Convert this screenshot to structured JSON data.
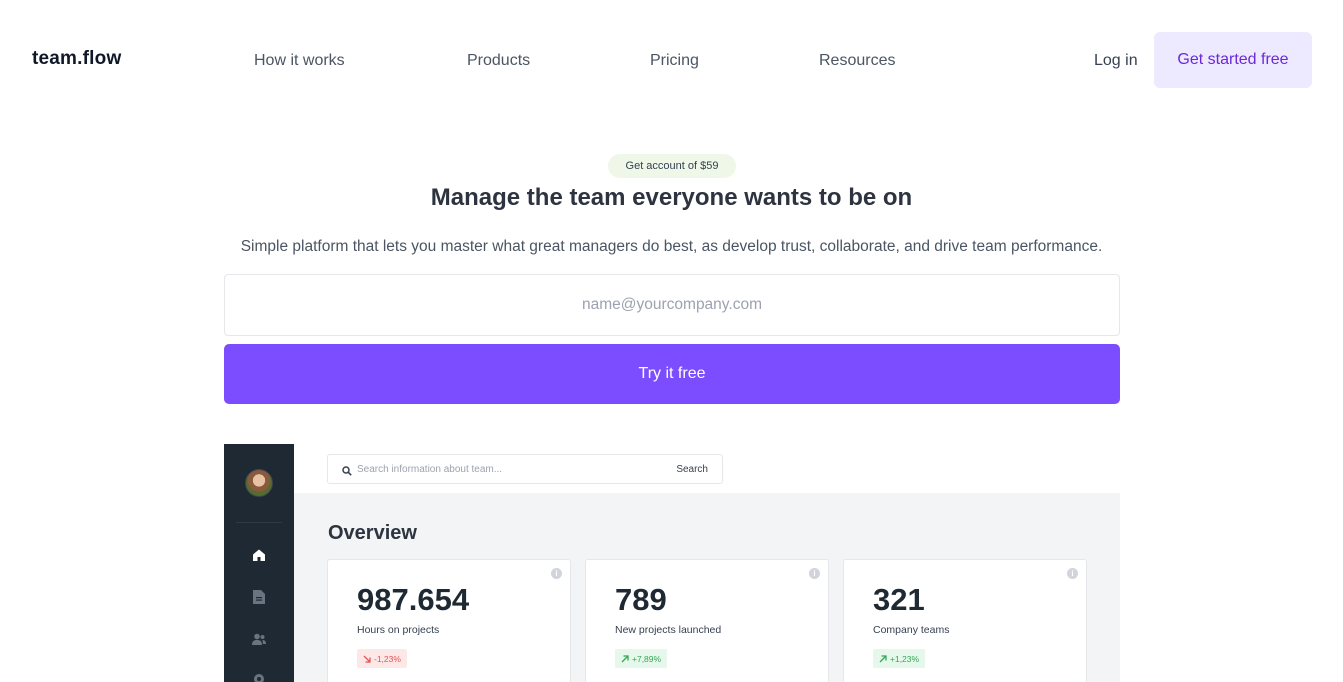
{
  "brand": {
    "logo": "team.flow"
  },
  "nav": {
    "links": [
      "How it works",
      "Products",
      "Pricing",
      "Resources"
    ],
    "login": "Log in",
    "cta": "Get started free"
  },
  "hero": {
    "badge": "Get account of $59",
    "title": "Manage the team everyone wants to be on",
    "subtitle": "Simple platform that lets you master what great managers do best, as develop trust, collaborate, and drive team performance.",
    "email_placeholder": "name@yourcompany.com",
    "try_button": "Try it free"
  },
  "dashboard": {
    "search_placeholder": "Search information about team...",
    "search_button": "Search",
    "overview_title": "Overview",
    "sidebar_icons": [
      "home-icon",
      "document-icon",
      "users-icon",
      "settings-icon"
    ],
    "cards": [
      {
        "value": "987.654",
        "label": "Hours on projects",
        "change": "-1,23%",
        "trend": "down"
      },
      {
        "value": "789",
        "label": "New projects launched",
        "change": "+7,89%",
        "trend": "up"
      },
      {
        "value": "321",
        "label": "Company teams",
        "change": "+1,23%",
        "trend": "up"
      }
    ]
  },
  "colors": {
    "accent": "#7c4dff",
    "cta_bg": "#ede9fe",
    "cta_text": "#6d28d9",
    "sidebar": "#1f2933",
    "negative": "#e55353",
    "positive": "#34a853"
  }
}
